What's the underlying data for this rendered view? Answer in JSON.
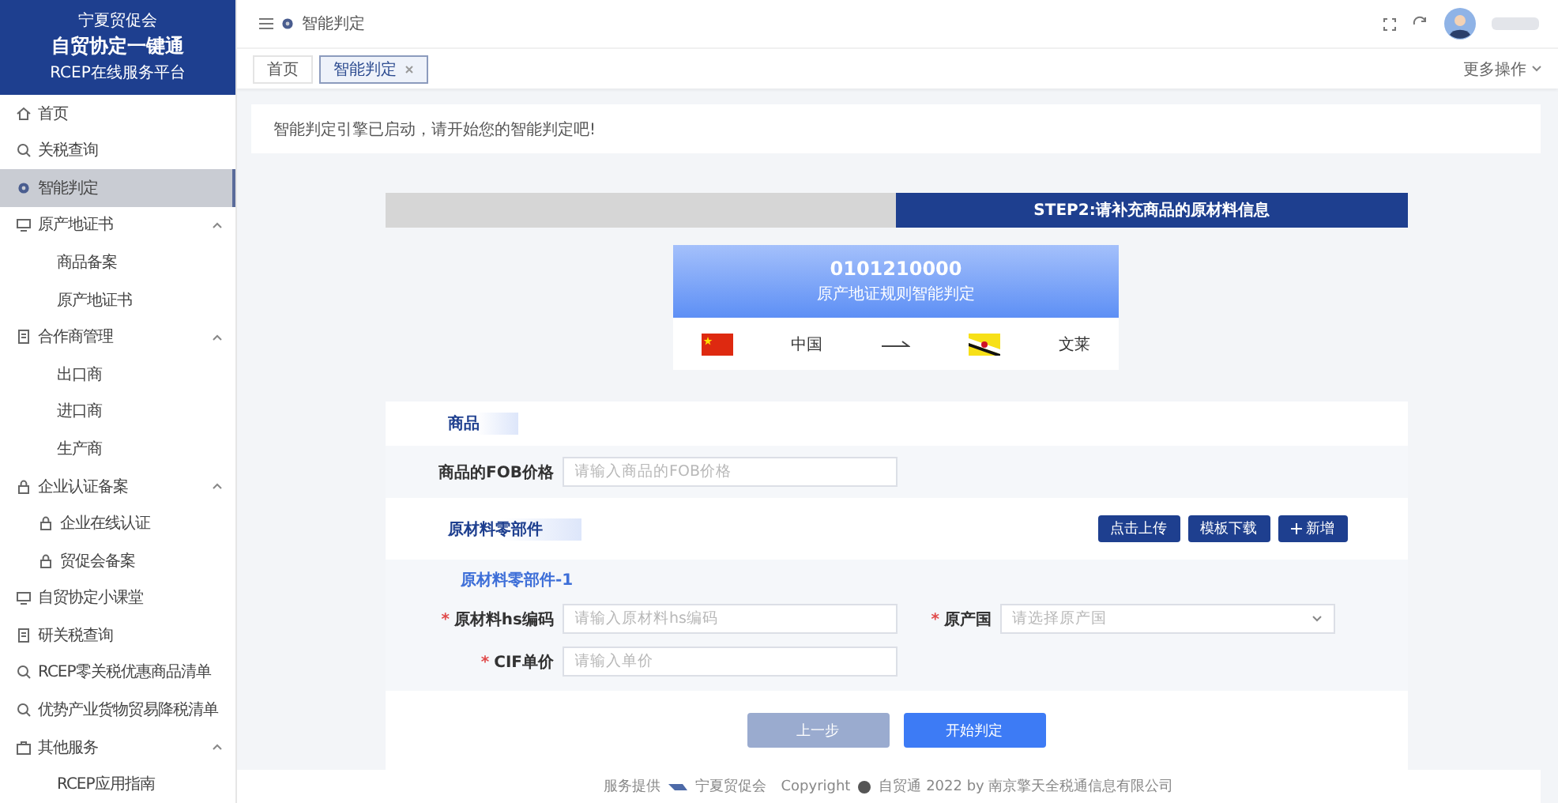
{
  "brand": {
    "org": "宁夏贸促会",
    "title": "自贸协定一键通",
    "subtitle": "RCEP在线服务平台"
  },
  "sidebar": {
    "items": [
      {
        "label": "首页",
        "selected": false
      },
      {
        "label": "关税查询",
        "selected": false
      },
      {
        "label": "智能判定",
        "selected": true
      },
      {
        "label": "原产地证书",
        "selected": false,
        "expanded": true,
        "children": [
          {
            "label": "商品备案",
            "selected": false
          },
          {
            "label": "原产地证书",
            "selected": false
          }
        ]
      },
      {
        "label": "合作商管理",
        "selected": false,
        "expanded": true,
        "children": [
          {
            "label": "出口商",
            "selected": false
          },
          {
            "label": "进口商",
            "selected": false
          },
          {
            "label": "生产商",
            "selected": false
          }
        ]
      },
      {
        "label": "企业认证备案",
        "selected": false,
        "expanded": true,
        "children": [
          {
            "label": "企业在线认证",
            "selected": false
          },
          {
            "label": "贸促会备案",
            "selected": false
          }
        ]
      },
      {
        "label": "自贸协定小课堂",
        "selected": false
      },
      {
        "label": "研关税查询",
        "selected": false
      },
      {
        "label": "RCEP零关税优惠商品清单",
        "selected": false
      },
      {
        "label": "优势产业货物贸易降税清单",
        "selected": false
      },
      {
        "label": "其他服务",
        "selected": false,
        "expanded": true,
        "children": [
          {
            "label": "RCEP应用指南",
            "selected": false
          }
        ]
      }
    ]
  },
  "breadcrumb": "智能判定",
  "tabs": [
    {
      "label": "首页",
      "selected": false,
      "closable": false
    },
    {
      "label": "智能判定",
      "selected": true,
      "closable": true
    }
  ],
  "more_actions": "更多操作",
  "notice": "智能判定引擎已启动，请开始您的智能判定吧!",
  "step_bar": [
    {
      "selected": false
    },
    {
      "label": "STEP2:请补充商品的原材料信息",
      "selected": true
    }
  ],
  "result": {
    "code": "0101210000",
    "caption": "原产地证规则智能判定",
    "from": "中国",
    "to": "文莱"
  },
  "goods_section": {
    "title": "商品",
    "fields": [
      {
        "label": "商品的FOB价格",
        "placeholder": "请输入商品的FOB价格",
        "kind": "input"
      }
    ]
  },
  "materials_section": {
    "title": "原材料零部件",
    "actions": [
      {
        "label": "点击上传",
        "kind": "plain"
      },
      {
        "label": "模板下载",
        "kind": "plain"
      },
      {
        "label": "新增",
        "kind": "add"
      }
    ],
    "parts": [
      {
        "title": "原材料零部件-1",
        "rows": [
          [
            {
              "mark": "*",
              "label": "原材料hs编码",
              "placeholder": "请输入原材料hs编码",
              "kind": "input"
            },
            {
              "mark": "*",
              "label": "原产国",
              "placeholder": "请选择原产国",
              "kind": "select"
            }
          ],
          [
            {
              "mark": "*",
              "label": "CIF单价",
              "placeholder": "请输入单价",
              "kind": "input"
            }
          ]
        ]
      }
    ]
  },
  "footer_buttons": [
    {
      "label": "上一步",
      "disabled": true
    },
    {
      "label": "开始判定",
      "disabled": false
    }
  ],
  "footer": {
    "provider_label": "服务提供",
    "provider": "宁夏贸促会",
    "copyright": "Copyright",
    "product": "自贸通 2022 by 南京擎天全税通信息有限公司"
  }
}
